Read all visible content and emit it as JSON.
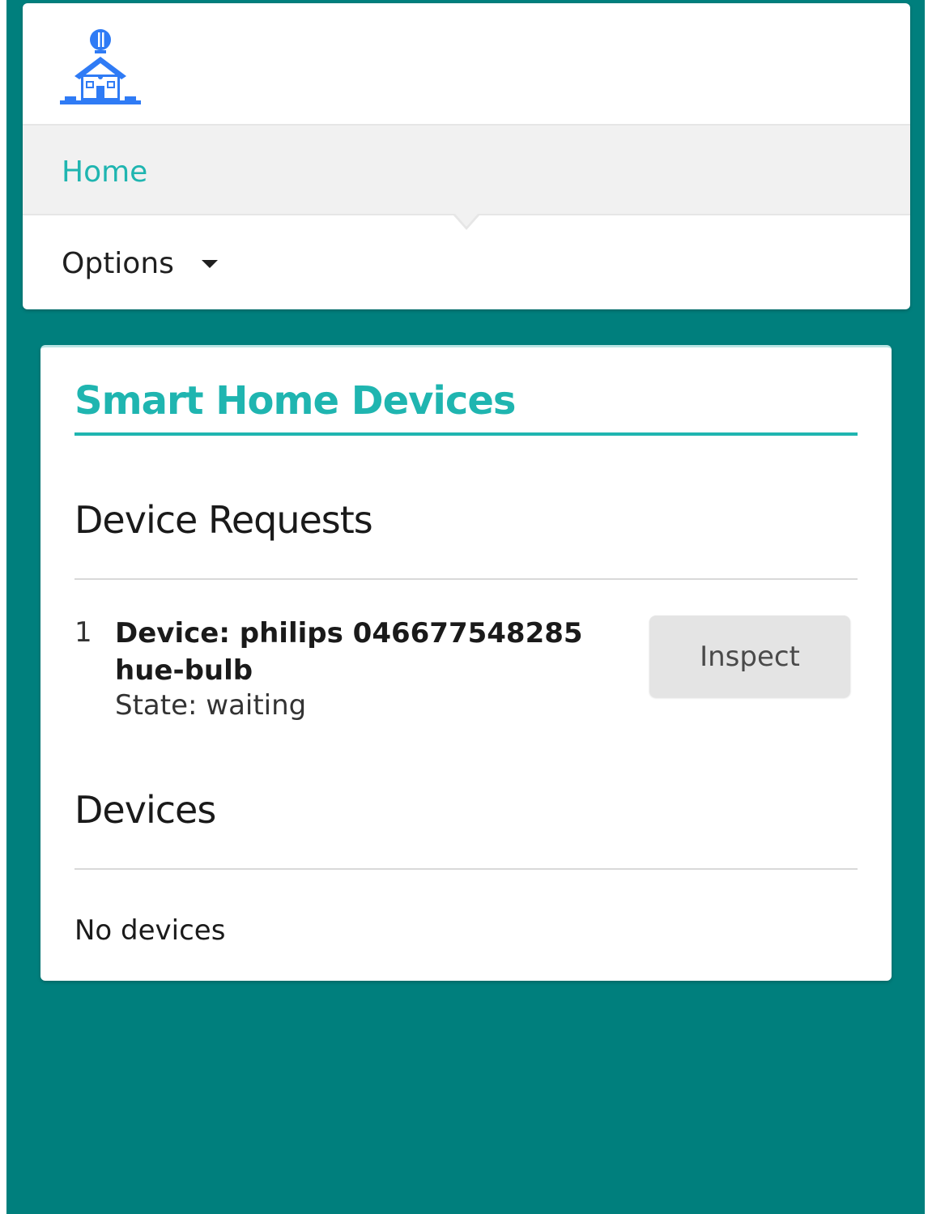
{
  "nav": {
    "logo_icon": "smart-home-house-icon",
    "items": [
      {
        "label": "Home",
        "active": true
      },
      {
        "label": "Options",
        "has_dropdown": true
      }
    ]
  },
  "main": {
    "title": "Smart Home Devices",
    "requests": {
      "heading": "Device Requests",
      "items": [
        {
          "index": "1",
          "name": "Device: philips 046677548285 hue-bulb",
          "state": "State: waiting",
          "action_label": "Inspect"
        }
      ]
    },
    "devices": {
      "heading": "Devices",
      "empty_text": "No devices"
    }
  },
  "colors": {
    "page_background": "#007f7d",
    "accent": "#1fb5b0",
    "card_background": "#ffffff",
    "nav_active_background": "#f1f1f1",
    "button_background": "#e4e4e4",
    "logo_blue": "#2f7bf5"
  }
}
